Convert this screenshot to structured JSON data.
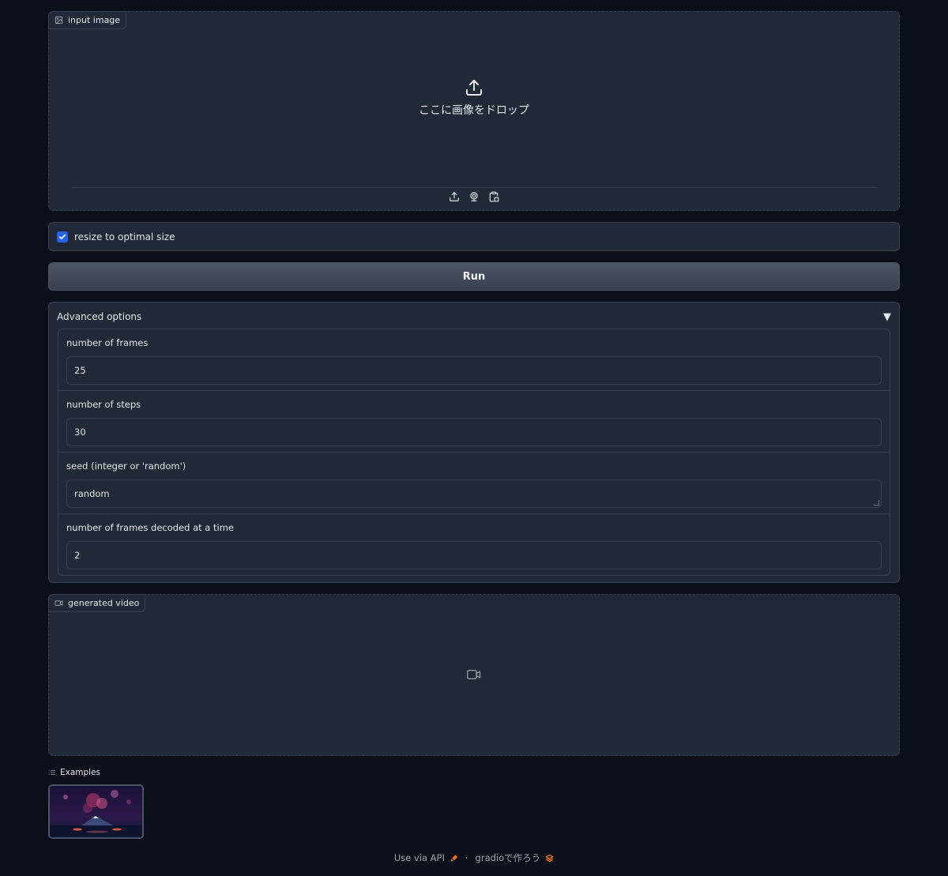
{
  "input_image": {
    "label": "input image",
    "drop_text": "ここに画像をドロップ"
  },
  "resize": {
    "label": "resize to optimal size",
    "checked": true
  },
  "run_button": {
    "label": "Run"
  },
  "advanced": {
    "title": "Advanced options",
    "fields": [
      {
        "label": "number of frames",
        "value": "25"
      },
      {
        "label": "number of steps",
        "value": "30"
      },
      {
        "label": "seed (integer or 'random')",
        "value": "random"
      },
      {
        "label": "number of frames decoded at a time",
        "value": "2"
      }
    ]
  },
  "generated_video": {
    "label": "generated video"
  },
  "examples": {
    "label": "Examples"
  },
  "footer": {
    "api_link": "Use via API",
    "separator": "·",
    "built_with": "gradioで作ろう"
  },
  "colors": {
    "background": "#0b0f19",
    "panel": "#1f2937",
    "accent": "#2563eb",
    "border": "#374151"
  }
}
